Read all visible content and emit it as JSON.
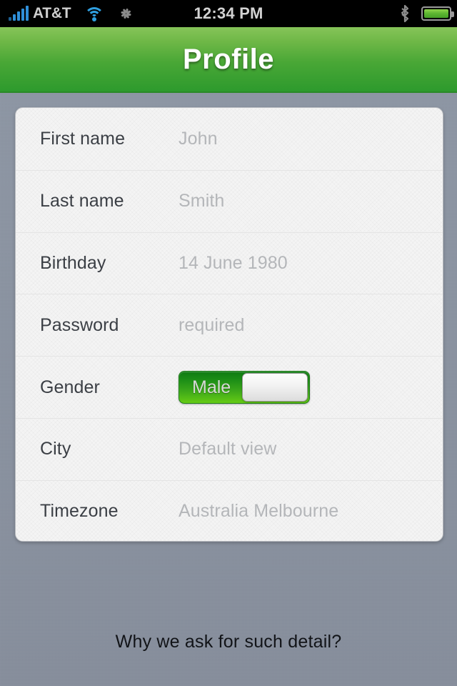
{
  "statusbar": {
    "signal_icon": "signal-bars-icon",
    "carrier": "AT&T",
    "wifi_icon": "wifi-icon",
    "sync_icon": "activity-spinner-icon",
    "time": "12:34 PM",
    "bluetooth_icon": "bluetooth-icon",
    "battery_icon": "battery-full-icon"
  },
  "header": {
    "title": "Profile"
  },
  "form": {
    "rows": [
      {
        "label": "First name",
        "value": "John",
        "type": "text"
      },
      {
        "label": "Last name",
        "value": "Smith",
        "type": "text"
      },
      {
        "label": "Birthday",
        "value": "14 June 1980",
        "type": "text"
      },
      {
        "label": "Password",
        "value": "required",
        "type": "text"
      },
      {
        "label": "Gender",
        "value": "Male",
        "type": "toggle"
      },
      {
        "label": "City",
        "value": "Default view",
        "type": "text"
      },
      {
        "label": "Timezone",
        "value": "Australia Melbourne",
        "type": "text"
      }
    ]
  },
  "footer": {
    "link": "Why we ask for such detail?"
  },
  "colors": {
    "header_green_top": "#86c459",
    "header_green_bottom": "#2d9a2d",
    "toggle_green_top": "#0e7a12",
    "toggle_green_bottom": "#66cc15",
    "page_background": "#8b94a2",
    "card_background": "#f4f4f4",
    "label_text": "#3b3f45",
    "value_text": "#b4b6b9",
    "status_text": "#d3d3d3",
    "signal_blue": "#2f8fd8"
  }
}
